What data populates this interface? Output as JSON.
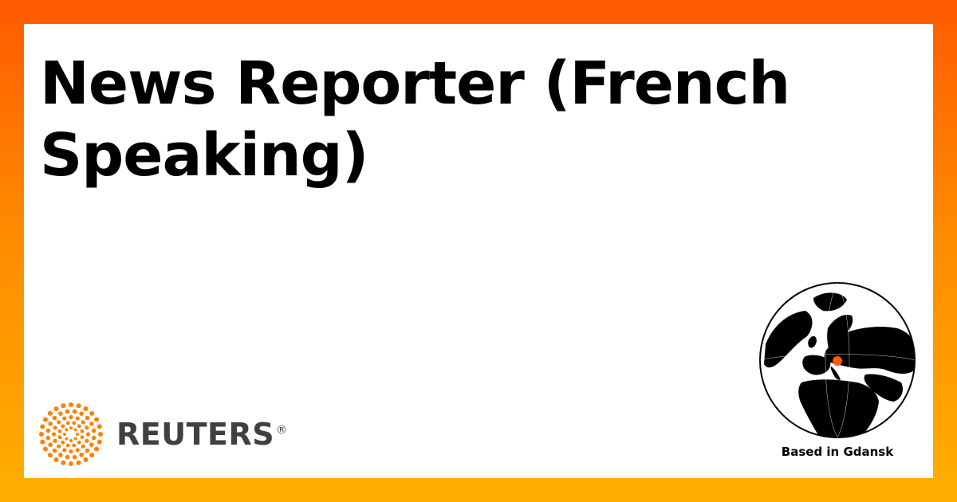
{
  "job": {
    "title": "News Reporter (French Speaking)"
  },
  "brand": {
    "name": "REUTERS",
    "registered_mark": "®",
    "logo_icon": "reuters-dot-ring-logo",
    "accent_color": "#ff8000",
    "text_color": "#404040"
  },
  "location": {
    "label": "Based in Gdansk",
    "globe_icon": "globe-europe-icon",
    "marker_color": "#ff5a00"
  },
  "colors": {
    "background_top": "#ff5a00",
    "background_bottom": "#ffae00",
    "card": "#ffffff"
  }
}
